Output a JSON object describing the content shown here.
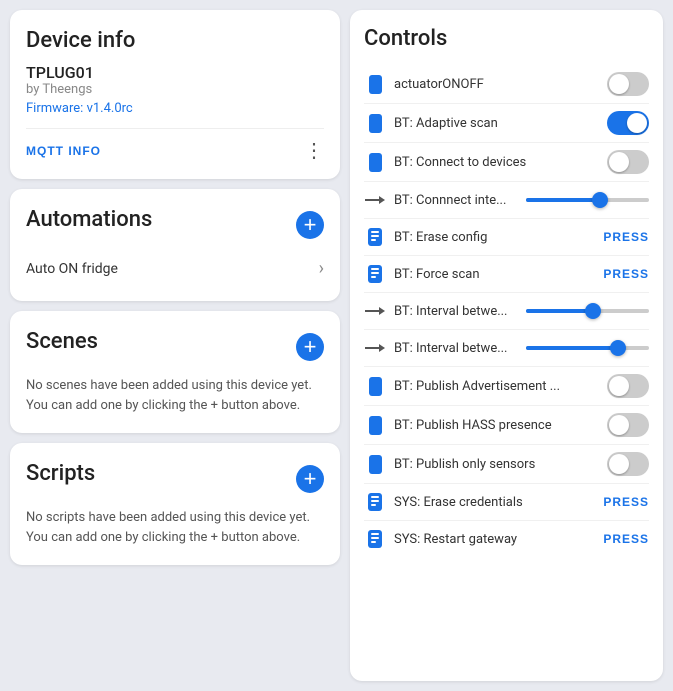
{
  "left": {
    "device_info": {
      "title": "Device info",
      "name": "TPLUG01",
      "by": "by Theengs",
      "firmware_label": "Firmware:",
      "firmware_version": "v1.4.0rc",
      "mqtt_btn": "MQTT INFO"
    },
    "automations": {
      "title": "Automations",
      "items": [
        {
          "label": "Auto ON fridge"
        }
      ]
    },
    "scenes": {
      "title": "Scenes",
      "desc": "No scenes have been added using this device yet. You can add one by clicking the + button above."
    },
    "scripts": {
      "title": "Scripts",
      "desc": "No scripts have been added using this device yet. You can add one by clicking the + button above."
    }
  },
  "controls": {
    "title": "Controls",
    "rows": [
      {
        "id": "actuatorONOFF",
        "label": "actuatorONOFF",
        "type": "toggle",
        "state": "off",
        "icon": "toggle"
      },
      {
        "id": "bt-adaptive-scan",
        "label": "BT: Adaptive scan",
        "type": "toggle",
        "state": "on",
        "icon": "toggle"
      },
      {
        "id": "bt-connect-to-devices",
        "label": "BT: Connect to devices",
        "type": "toggle",
        "state": "off",
        "icon": "toggle"
      },
      {
        "id": "bt-connect-inte",
        "label": "BT: Connnect inte...",
        "type": "slider",
        "value": 60,
        "icon": "arrow"
      },
      {
        "id": "bt-erase-config",
        "label": "BT: Erase config",
        "type": "press",
        "icon": "hand"
      },
      {
        "id": "bt-force-scan",
        "label": "BT: Force scan",
        "type": "press",
        "icon": "hand"
      },
      {
        "id": "bt-interval-betw1",
        "label": "BT: Interval betwe...",
        "type": "slider",
        "value": 55,
        "icon": "arrow"
      },
      {
        "id": "bt-interval-betw2",
        "label": "BT: Interval betwe...",
        "type": "slider",
        "value": 75,
        "icon": "arrow"
      },
      {
        "id": "bt-publish-adv",
        "label": "BT: Publish Advertisement ...",
        "type": "toggle",
        "state": "off",
        "icon": "toggle"
      },
      {
        "id": "bt-publish-hass",
        "label": "BT: Publish HASS presence",
        "type": "toggle",
        "state": "off",
        "icon": "toggle"
      },
      {
        "id": "bt-publish-only-sensors",
        "label": "BT: Publish only sensors",
        "type": "toggle",
        "state": "off",
        "icon": "toggle"
      },
      {
        "id": "sys-erase-credentials",
        "label": "SYS: Erase credentials",
        "type": "press",
        "icon": "hand"
      },
      {
        "id": "sys-restart-gateway",
        "label": "SYS: Restart gateway",
        "type": "press",
        "icon": "hand"
      }
    ],
    "press_label": "PRESS",
    "add_label": "+",
    "three_dots": "⋮"
  }
}
